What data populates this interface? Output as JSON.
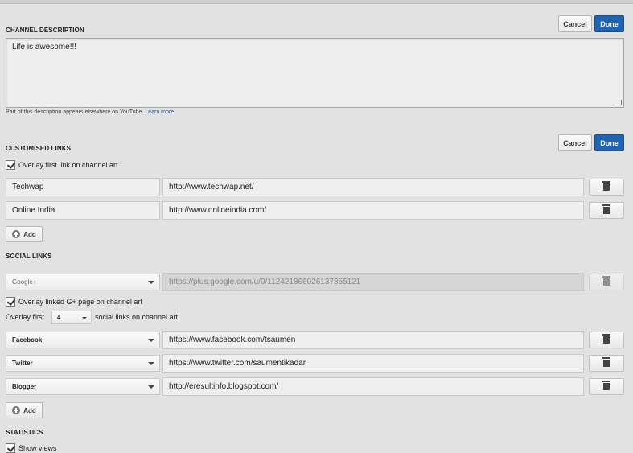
{
  "description": {
    "title": "CHANNEL DESCRIPTION",
    "cancel_label": "Cancel",
    "done_label": "Done",
    "text": "Life is awesome!!!",
    "hint": "Part of this description appears elsewhere on YouTube.",
    "learn_more": "Learn more"
  },
  "custom_links": {
    "title": "CUSTOMISED LINKS",
    "cancel_label": "Cancel",
    "done_label": "Done",
    "overlay_label": "Overlay first link on channel art",
    "rows": [
      {
        "title": "Techwap",
        "url": "http://www.techwap.net/"
      },
      {
        "title": "Online India",
        "url": "http://www.onlineindia.com/"
      }
    ],
    "add_label": "Add"
  },
  "social_links": {
    "title": "SOCIAL LINKS",
    "google": {
      "network": "Google+",
      "url": "https://plus.google.com/u/0/112421866026137855121"
    },
    "overlay_gplus_label": "Overlay linked G+ page on channel art",
    "overlay_first_prefix": "Overlay first",
    "overlay_first_count": "4",
    "overlay_first_suffix": "social links on channel art",
    "rows": [
      {
        "network": "Facebook",
        "url": "https://www.facebook.com/tsaumen"
      },
      {
        "network": "Twitter",
        "url": "https://www.twitter.com/saumentikadar"
      },
      {
        "network": "Blogger",
        "url": "http://eresultinfo.blogspot.com/"
      }
    ],
    "add_label": "Add"
  },
  "statistics": {
    "title": "STATISTICS",
    "show_views_label": "Show views"
  },
  "icons": {
    "trash": "trash-icon",
    "add": "plus-circle-icon",
    "check": "checkmark-icon",
    "dropdown": "chevron-down-icon"
  },
  "colors": {
    "background": "#e2e2e2",
    "primary_button": "#1f64b2",
    "link": "#1a5fa8"
  }
}
